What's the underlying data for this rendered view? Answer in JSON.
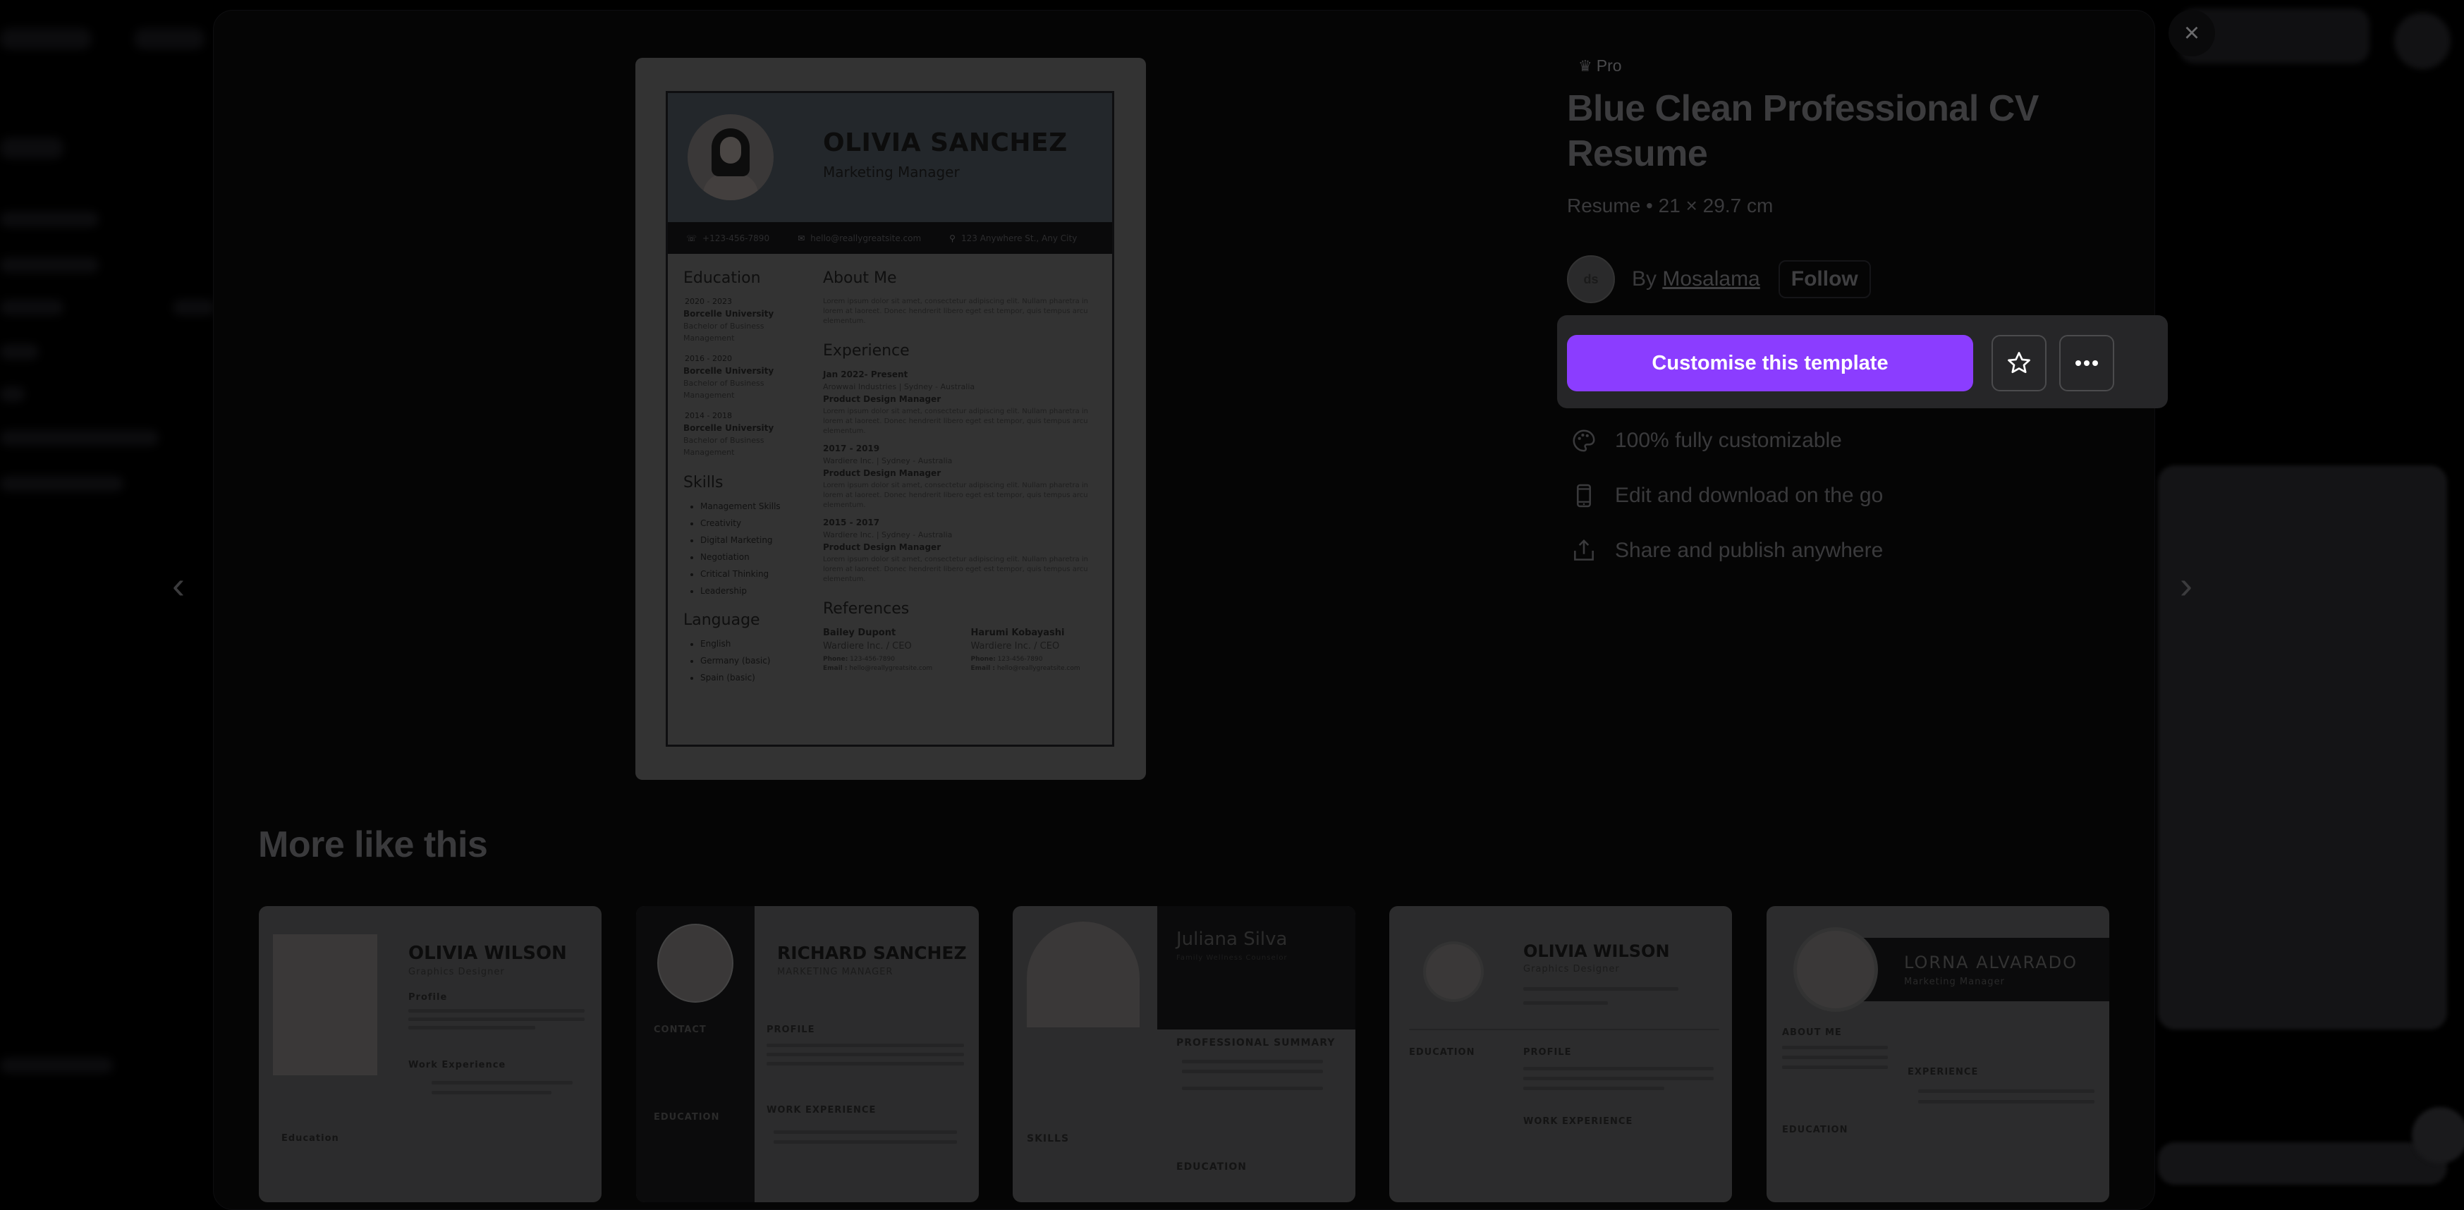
{
  "modal": {
    "close_label": "×",
    "prev_label": "‹",
    "next_label": "›"
  },
  "preview": {
    "name": "OLIVIA SANCHEZ",
    "role": "Marketing Manager",
    "contact": {
      "phone": "+123-456-7890",
      "email": "hello@reallygreatsite.com",
      "address": "123 Anywhere St., Any City"
    },
    "education": {
      "heading": "Education",
      "items": [
        {
          "years": "2020 - 2023",
          "school": "Borcelle University",
          "degree": "Bachelor of Business Management"
        },
        {
          "years": "2016 - 2020",
          "school": "Borcelle University",
          "degree": "Bachelor of Business Management"
        },
        {
          "years": "2014 - 2018",
          "school": "Borcelle University",
          "degree": "Bachelor of Business Management"
        }
      ]
    },
    "skills": {
      "heading": "Skills",
      "items": [
        "Management Skills",
        "Creativity",
        "Digital Marketing",
        "Negotiation",
        "Critical Thinking",
        "Leadership"
      ]
    },
    "language": {
      "heading": "Language",
      "items": [
        "English",
        "Germany (basic)",
        "Spain (basic)"
      ]
    },
    "about": {
      "heading": "About Me",
      "text": "Lorem ipsum dolor sit amet, consectetur adipiscing elit. Nullam pharetra in lorem at laoreet. Donec hendrerit libero eget est tempor, quis tempus arcu elementum."
    },
    "experience": {
      "heading": "Experience",
      "items": [
        {
          "period": "Jan 2022- Present",
          "company": "Arowwai Industries | Sydney - Australia",
          "title": "Product Design Manager",
          "text": "Lorem ipsum dolor sit amet, consectetur adipiscing elit. Nullam pharetra in lorem at laoreet. Donec hendrerit libero eget est tempor, quis tempus arcu elementum."
        },
        {
          "period": "2017 - 2019",
          "company": "Wardiere Inc. | Sydney - Australia",
          "title": "Product Design Manager",
          "text": "Lorem ipsum dolor sit amet, consectetur adipiscing elit. Nullam pharetra in lorem at laoreet. Donec hendrerit libero eget est tempor, quis tempus arcu elementum."
        },
        {
          "period": "2015 - 2017",
          "company": "Wardiere Inc. | Sydney - Australia",
          "title": "Product Design Manager",
          "text": "Lorem ipsum dolor sit amet, consectetur adipiscing elit. Nullam pharetra in lorem at laoreet. Donec hendrerit libero eget est tempor, quis tempus arcu elementum."
        }
      ]
    },
    "references": {
      "heading": "References",
      "phone_label": "Phone:",
      "email_label": "Email :",
      "items": [
        {
          "name": "Bailey Dupont",
          "company": "Wardiere Inc. / CEO",
          "phone": "123-456-7890",
          "email": "hello@reallygreatsite.com"
        },
        {
          "name": "Harumi Kobayashi",
          "company": "Wardiere Inc. / CEO",
          "phone": "123-456-7890",
          "email": "hello@reallygreatsite.com"
        }
      ]
    }
  },
  "details": {
    "badge": "Pro",
    "title": "Blue Clean Professional CV Resume",
    "subtitle": "Resume • 21 × 29.7 cm",
    "creator_prefix": "By",
    "creator_name": "Mosalama",
    "creator_avatar_text": "ds",
    "follow_label": "Follow",
    "customise_label": "Customise this template",
    "accent_color": "#8b3dff",
    "features": [
      {
        "icon": "palette-icon",
        "label": "100% fully customizable"
      },
      {
        "icon": "phone-icon",
        "label": "Edit and download on the go"
      },
      {
        "icon": "share-icon",
        "label": "Share and publish anywhere"
      }
    ]
  },
  "more": {
    "heading": "More like this",
    "templates": [
      {
        "name": "OLIVIA WILSON",
        "role": "Graphics Designer",
        "sections": [
          "Profile",
          "Work Experience",
          "Education"
        ]
      },
      {
        "name": "RICHARD SANCHEZ",
        "role": "MARKETING MANAGER",
        "sections": [
          "CONTACT",
          "PROFILE",
          "EDUCATION",
          "WORK EXPERIENCE"
        ]
      },
      {
        "name": "Juliana Silva",
        "role": "Family Wellness Counselor",
        "sections": [
          "PROFESSIONAL SUMMARY",
          "SKILLS",
          "EDUCATION"
        ]
      },
      {
        "name": "OLIVIA WILSON",
        "role": "Graphics Designer",
        "sections": [
          "EDUCATION",
          "PROFILE",
          "WORK EXPERIENCE"
        ]
      },
      {
        "name": "LORNA ALVARADO",
        "role": "Marketing Manager",
        "sections": [
          "ABOUT ME",
          "EXPERIENCE",
          "EDUCATION"
        ]
      }
    ]
  }
}
